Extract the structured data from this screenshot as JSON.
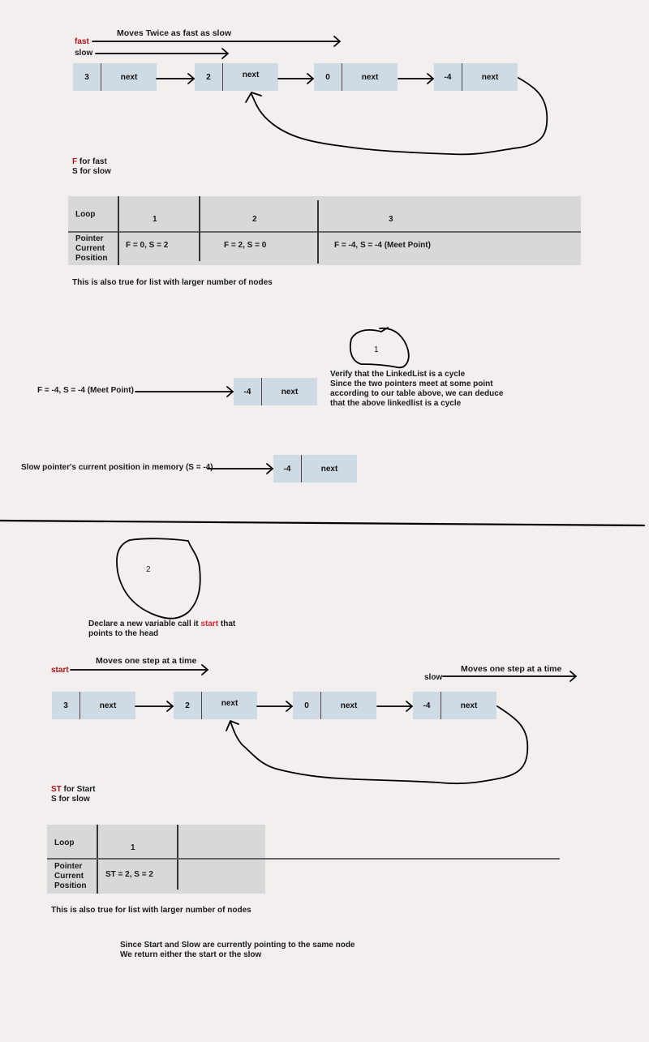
{
  "section1": {
    "pointer_caption": "Moves Twice as fast as slow",
    "fast_label": "fast",
    "slow_label": "slow",
    "nodes": [
      {
        "value": "3",
        "next": "next"
      },
      {
        "value": "2",
        "next": "next"
      },
      {
        "value": "0",
        "next": "next"
      },
      {
        "value": "-4",
        "next": "next"
      }
    ],
    "legend": {
      "f_letter": "F",
      "f_rest": " for fast",
      "s_line": "S for slow"
    },
    "table": {
      "row_headers": [
        "Loop",
        "Pointer Current Position"
      ],
      "row_header_lines": [
        "Pointer",
        "Current",
        "Position"
      ],
      "columns": [
        "1",
        "2",
        "3"
      ],
      "values": [
        "F = 0, S = 2",
        "F = 2, S = 0",
        "F = -4, S = -4  (Meet Point)"
      ]
    },
    "note": "This is also true for list with larger number of nodes"
  },
  "step1": {
    "badge": "1",
    "meet_label": "F = -4, S = -4  (Meet Point)",
    "node": {
      "value": "-4",
      "next": "next"
    },
    "explanation": [
      "Verify that the LinkedList is a cycle",
      "Since the two pointers meet at some point",
      "according to our table above, we can deduce",
      "that the above linkedlist is a cycle"
    ],
    "slow_label": "Slow pointer's  current position in memory (S = -4)",
    "slow_node": {
      "value": "-4",
      "next": "next"
    }
  },
  "step2": {
    "badge": "2",
    "declare_before": "Declare a new variable call it ",
    "declare_highlight": "start",
    "declare_after": " that",
    "declare_line2": "points to the head",
    "start_label": "start",
    "start_caption": "Moves one step at a time",
    "slow_label": "slow",
    "slow_caption": "Moves one step at a time",
    "nodes": [
      {
        "value": "3",
        "next": "next"
      },
      {
        "value": "2",
        "next": "next"
      },
      {
        "value": "0",
        "next": "next"
      },
      {
        "value": "-4",
        "next": "next"
      }
    ],
    "legend": {
      "st_letter": "ST",
      "st_rest": " for Start",
      "s_line": "S for slow"
    },
    "table": {
      "row_headers": [
        "Loop",
        "Pointer Current Position"
      ],
      "row_header_lines": [
        "Pointer",
        "Current",
        "Position"
      ],
      "columns": [
        "1",
        ""
      ],
      "values": [
        "ST = 2, S = 2",
        ""
      ]
    },
    "note": "This is also true for list with larger number of nodes",
    "conclusion": [
      "Since Start and Slow are currently pointing to the same node",
      "We return either the start or the slow"
    ]
  },
  "colors": {
    "background": "#f2efee",
    "node_fill": "#cfdbe4",
    "table_fill": "#d8d8d8",
    "accent_red": "#b1141a",
    "highlight_red": "#e0252b"
  }
}
